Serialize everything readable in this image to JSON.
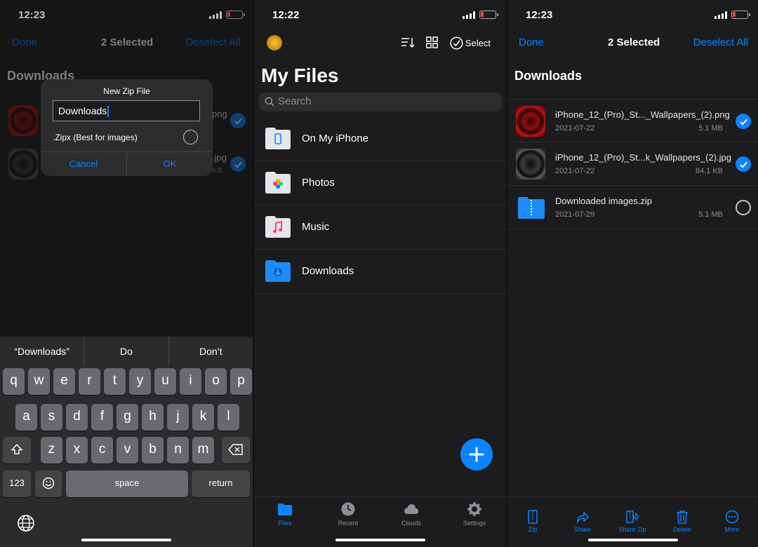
{
  "left": {
    "status": {
      "time": "12:23"
    },
    "nav": {
      "done": "Done",
      "title": "2 Selected",
      "deselect": "Deselect All"
    },
    "section": "Downloads",
    "files": [
      {
        "name": "iPhone_12_(Pro)_St..._Wallpapers_(2).png",
        "visible_tail": "png",
        "size_tail": ""
      },
      {
        "name": "iPhone_12_(Pro)_St...k_Wallpapers_(2).jpg",
        "visible_tail": ".jpg",
        "size_tail": "KB"
      }
    ],
    "dialog": {
      "title": "New Zip File",
      "input_value": "Downloads",
      "option": ".Zipx (Best for images)",
      "cancel": "Cancel",
      "ok": "OK"
    },
    "keyboard": {
      "suggestions": [
        "“Downloads”",
        "Do",
        "Don’t"
      ],
      "row1": [
        "q",
        "w",
        "e",
        "r",
        "t",
        "y",
        "u",
        "i",
        "o",
        "p"
      ],
      "row2": [
        "a",
        "s",
        "d",
        "f",
        "g",
        "h",
        "j",
        "k",
        "l"
      ],
      "row3": [
        "z",
        "x",
        "c",
        "v",
        "b",
        "n",
        "m"
      ],
      "num": "123",
      "space": "space",
      "return": "return"
    }
  },
  "middle": {
    "status": {
      "time": "12:22"
    },
    "toolbar": {
      "select": "Select"
    },
    "title": "My Files",
    "search": {
      "placeholder": "Search"
    },
    "folders": [
      {
        "label": "On My iPhone",
        "icon": "iphone-folder-icon"
      },
      {
        "label": "Photos",
        "icon": "photos-folder-icon"
      },
      {
        "label": "Music",
        "icon": "music-folder-icon"
      },
      {
        "label": "Downloads",
        "icon": "downloads-folder-icon"
      }
    ],
    "tabs": [
      {
        "label": "Files",
        "active": true
      },
      {
        "label": "Recent",
        "active": false
      },
      {
        "label": "Clouds",
        "active": false
      },
      {
        "label": "Settings",
        "active": false
      }
    ]
  },
  "right": {
    "status": {
      "time": "12:23"
    },
    "nav": {
      "done": "Done",
      "title": "2 Selected",
      "deselect": "Deselect All"
    },
    "section": "Downloads",
    "files": [
      {
        "name": "iPhone_12_(Pro)_St..._Wallpapers_(2).png",
        "date": "2021-07-22",
        "size": "5.1 MB",
        "selected": true
      },
      {
        "name": "iPhone_12_(Pro)_St...k_Wallpapers_(2).jpg",
        "date": "2021-07-22",
        "size": "84.1 KB",
        "selected": true
      },
      {
        "name": "Downloaded images.zip",
        "date": "2021-07-29",
        "size": "5.1 MB",
        "selected": false
      }
    ],
    "actions": [
      "Zip",
      "Share",
      "Share Zip",
      "Delete",
      "More"
    ]
  },
  "colors": {
    "accent": "#0a84ff",
    "background": "#1c1c1e",
    "battery_low": "#ff453a"
  }
}
